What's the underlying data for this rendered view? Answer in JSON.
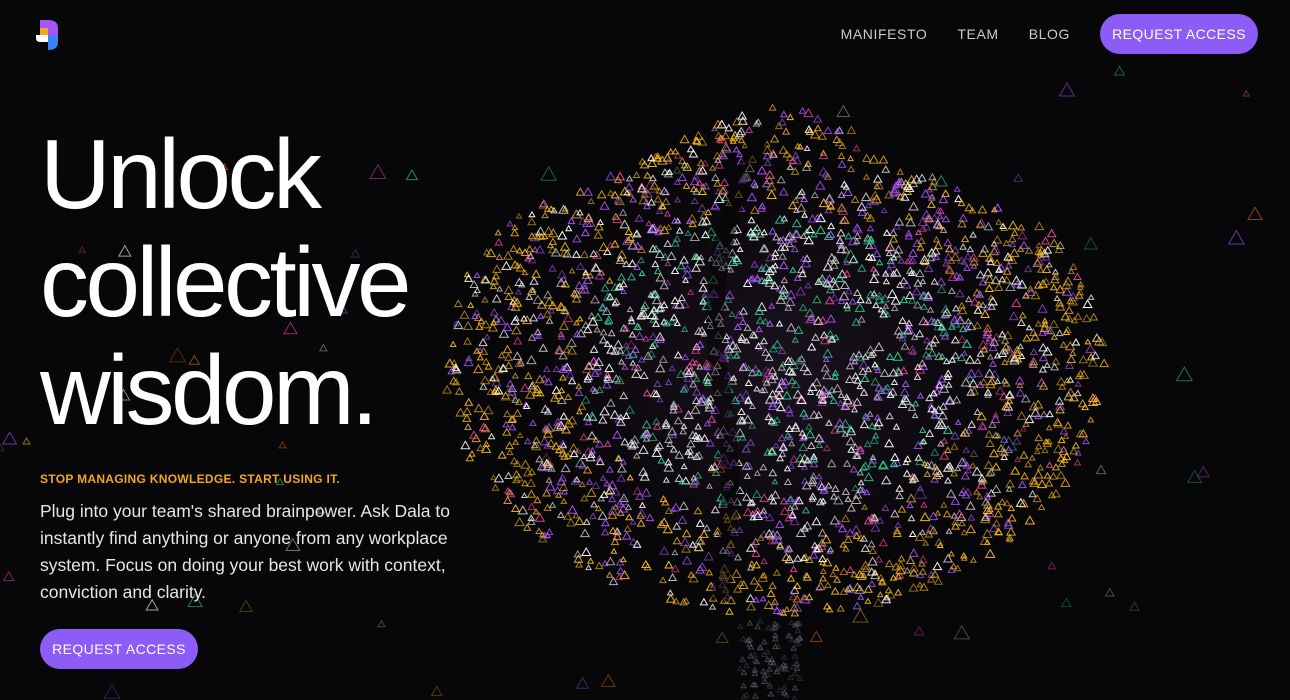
{
  "header": {
    "nav": [
      "MANIFESTO",
      "TEAM",
      "BLOG"
    ],
    "cta_label": "REQUEST ACCESS"
  },
  "hero": {
    "title_lines": [
      "Unlock",
      "collective",
      "wisdom."
    ],
    "kicker": "STOP MANAGING KNOWLEDGE. START USING IT.",
    "description": "Plug into your team's shared brainpower. Ask Dala to instantly find anything or anyone from any workplace system. Focus on doing your best work with context, conviction and clarity.",
    "cta_label": "REQUEST ACCESS"
  },
  "illustration": {
    "icon": "brain-particles-illustration",
    "colors": [
      "#f5b822",
      "#a855f7",
      "#ffffff",
      "#34d399",
      "#f97316",
      "#ec4899"
    ]
  },
  "logo": {
    "icon": "dala-logo-icon",
    "colors": [
      "#a855f7",
      "#f5a524",
      "#3b82f6",
      "#ffffff"
    ]
  },
  "theme": {
    "accent": "#8b5cf6",
    "kicker": "#f5a524",
    "background": "#070608"
  }
}
